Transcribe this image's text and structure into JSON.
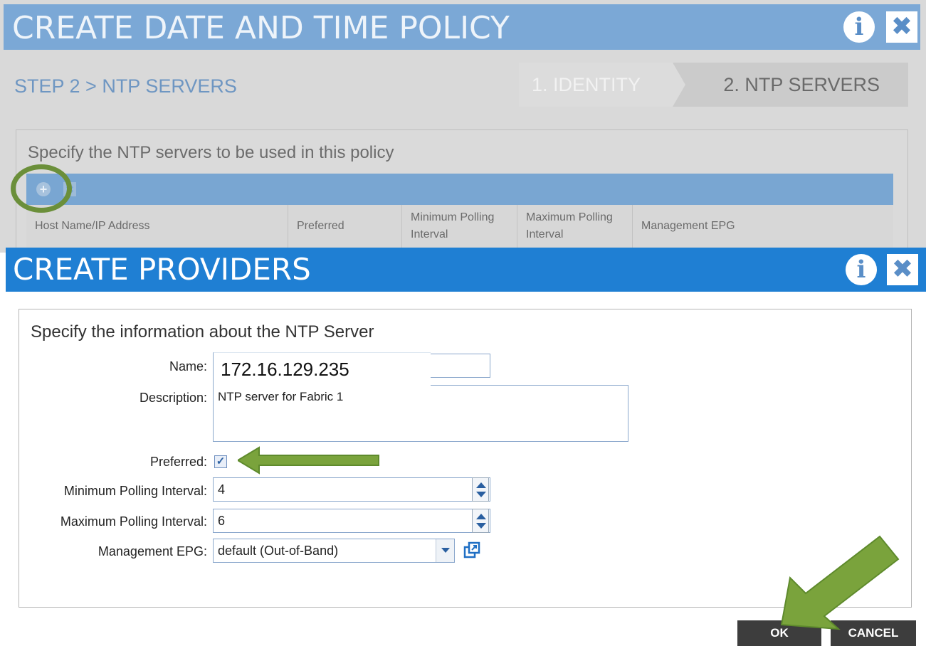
{
  "background_dialog": {
    "title": "CREATE DATE AND TIME POLICY",
    "info_icon": "i",
    "close_icon": "✖",
    "step_label": "STEP 2 > NTP SERVERS",
    "wizard_steps": [
      "1. IDENTITY",
      "2. NTP SERVERS"
    ],
    "panel_text": "Specify the NTP servers to be used in this policy",
    "toolbar": {
      "add_icon": "+",
      "delete_icon": "✖"
    },
    "table_headers": [
      "Host Name/IP Address",
      "Preferred",
      "Minimum Polling Interval",
      "Maximum Polling Interval",
      "Management EPG"
    ]
  },
  "providers_dialog": {
    "title": "CREATE PROVIDERS",
    "info_icon": "i",
    "close_icon": "✖",
    "heading": "Specify the information about the NTP Server",
    "fields": {
      "name_label": "Name:",
      "name_value": "172.16.129.235",
      "description_label": "Description:",
      "description_value": "NTP server for Fabric 1",
      "preferred_label": "Preferred:",
      "preferred_checked": true,
      "preferred_mark": "✓",
      "min_poll_label": "Minimum Polling Interval:",
      "min_poll_value": "4",
      "max_poll_label": "Maximum Polling Interval:",
      "max_poll_value": "6",
      "epg_label": "Management EPG:",
      "epg_value": "default (Out-of-Band)"
    },
    "buttons": {
      "ok": "OK",
      "cancel": "CANCEL"
    }
  },
  "colors": {
    "titlebar_active": "#1f7fd3",
    "titlebar_dimmed": "#7ba8d6",
    "callout_green": "#7aa33c",
    "button_dark": "#3d3d3d"
  }
}
